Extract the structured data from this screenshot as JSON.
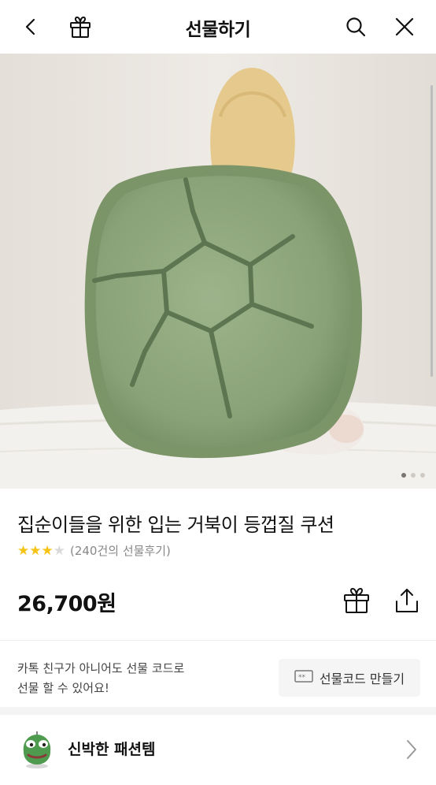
{
  "header": {
    "title": "선물하기",
    "icons": [
      "back-arrow-icon",
      "gift-icon",
      "search-icon",
      "close-icon"
    ]
  },
  "product": {
    "title": "집순이들을 위한 입는 거북이 등껍질 쿠션",
    "rating": 3,
    "rating_max": 5,
    "review_text": "(240건의 선물후기)",
    "price": "26,700원"
  },
  "carousel": {
    "pages": 3,
    "current": 1
  },
  "gift_code": {
    "line1": "카톡 친구가 아니어도 선물 코드로",
    "line2": "선물 할 수 있어요!",
    "button_label": "선물코드 만들기"
  },
  "brand": {
    "name": "신박한 패션템"
  },
  "colors": {
    "star": "#f6c417",
    "shell": "#8fa77d"
  }
}
